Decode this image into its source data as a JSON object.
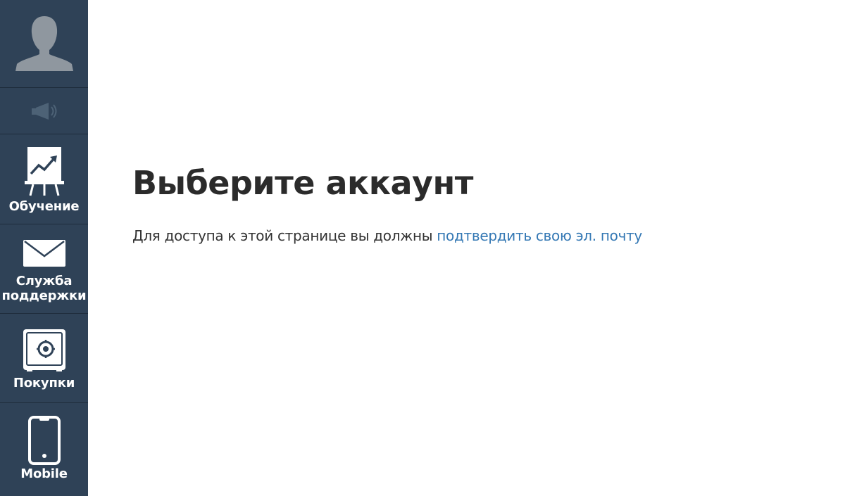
{
  "sidebar": {
    "items": [
      {
        "id": "avatar",
        "icon": "user-avatar-icon"
      },
      {
        "id": "sound",
        "icon": "megaphone-icon"
      },
      {
        "id": "training",
        "icon": "presentation-chart-icon",
        "label": "Обучение"
      },
      {
        "id": "support",
        "icon": "envelope-icon",
        "label_line1": "Служба",
        "label_line2": "поддержки"
      },
      {
        "id": "purchases",
        "icon": "safe-icon",
        "label": "Покупки"
      },
      {
        "id": "mobile",
        "icon": "smartphone-icon",
        "label": "Mobile"
      }
    ]
  },
  "main": {
    "title": "Выберите аккаунт",
    "message_prefix": "Для доступа к этой странице вы должны ",
    "message_link": "подтвердить свою эл. почту"
  },
  "colors": {
    "sidebar_bg": "#2f4257",
    "link": "#3478b4",
    "title": "#2b2b2b"
  }
}
